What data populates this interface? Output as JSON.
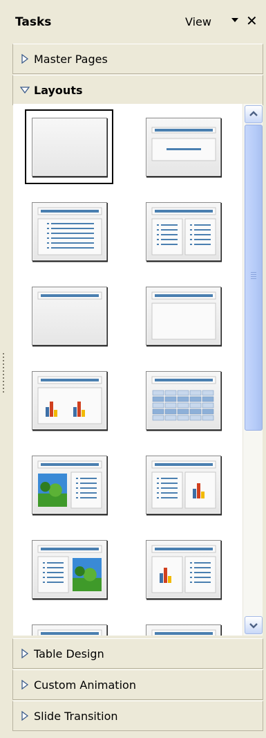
{
  "header": {
    "title": "Tasks",
    "view_label": "View",
    "close_glyph": "✕"
  },
  "sections": {
    "master_pages": "Master Pages",
    "layouts": "Layouts",
    "table_design": "Table Design",
    "custom_animation": "Custom Animation",
    "slide_transition": "Slide Transition"
  },
  "layouts": [
    {
      "name": "blank",
      "selected": true
    },
    {
      "name": "title-slide"
    },
    {
      "name": "title-content"
    },
    {
      "name": "title-2-content"
    },
    {
      "name": "title-only"
    },
    {
      "name": "centered-text"
    },
    {
      "name": "title-2-charts"
    },
    {
      "name": "title-table"
    },
    {
      "name": "title-image-content"
    },
    {
      "name": "title-content-chart"
    },
    {
      "name": "title-content-image"
    },
    {
      "name": "title-chart-content"
    },
    {
      "name": "partial-1"
    },
    {
      "name": "partial-2"
    }
  ],
  "icons": {
    "collapsed": "triangle-right-icon",
    "expanded": "triangle-down-icon",
    "scroll_up": "chevron-up-icon",
    "scroll_down": "chevron-down-icon"
  },
  "colors": {
    "panel_bg": "#ece9d8",
    "accent": "#4a7fb0",
    "scroll_thumb": "#b5cbf8"
  }
}
